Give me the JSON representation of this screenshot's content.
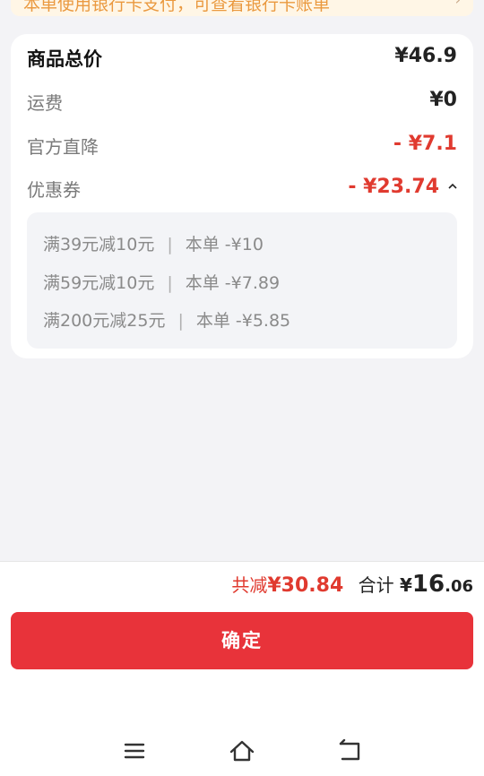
{
  "banner": {
    "text": "本单使用银行卡支付，可查看银行卡账单"
  },
  "price_card": {
    "total_label": "商品总价",
    "total_value": "¥46.9",
    "shipping_label": "运费",
    "shipping_value": "¥0",
    "official_label": "官方直降",
    "official_value": "- ¥7.1",
    "coupon_label": "优惠券",
    "coupon_value": "- ¥23.74",
    "coupons": [
      {
        "rule": "满39元减10元",
        "sep": "|",
        "detail": "本单 -¥10"
      },
      {
        "rule": "满59元减10元",
        "sep": "|",
        "detail": "本单 -¥7.89"
      },
      {
        "rule": "满200元减25元",
        "sep": "|",
        "detail": "本单 -¥5.85"
      }
    ]
  },
  "summary": {
    "reduce_label": "共减",
    "reduce_value": "¥30.84",
    "total_label": "合计",
    "yen": "¥",
    "total_int": "16",
    "total_dec": ".06"
  },
  "confirm_label": "确定",
  "colors": {
    "accent": "#e8333a",
    "discount": "#e03a2f"
  },
  "icons": [
    "chevron-up-icon",
    "menu-icon",
    "home-icon",
    "back-icon"
  ]
}
